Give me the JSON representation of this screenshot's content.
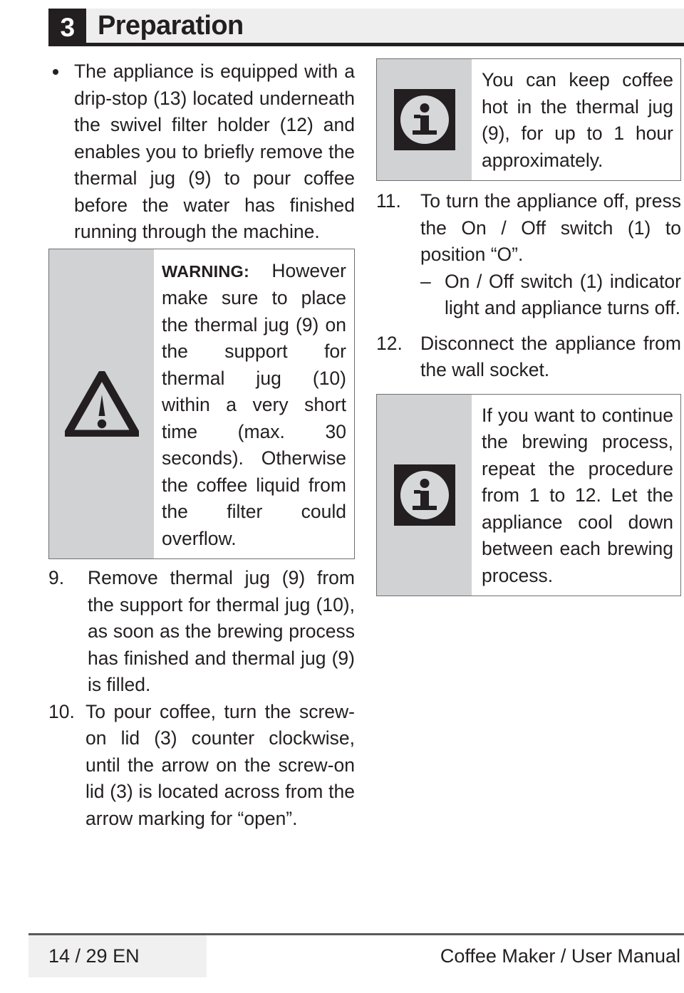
{
  "header": {
    "chapter_number": "3",
    "chapter_title": "Preparation"
  },
  "left_column": {
    "bullet": {
      "text": "The appliance is equipped with a drip-stop (13) located underneath the swivel filter holder (12) and enables you to briefly remove the thermal jug (9) to pour coffee before the water has finished running through the machine."
    },
    "warning_box": {
      "icon": "warning-triangle-icon",
      "label": "WARNING:",
      "text": "However make sure to place the thermal jug (9) on the support for thermal jug (10) within a very short time (max. 30 seconds). Otherwise the coffee liquid from the filter could overflow."
    },
    "steps": [
      {
        "number": "9.",
        "text": "Remove thermal jug (9) from the support for thermal jug (10), as soon as the brewing process has finished and thermal jug (9) is filled."
      },
      {
        "number": "10.",
        "text": "To pour coffee, turn the screw-on lid (3) counter clockwise, until the arrow on the screw-on lid (3) is located across from the arrow marking for “open”."
      }
    ]
  },
  "right_column": {
    "info_box_top": {
      "icon": "info-icon",
      "text": "You can keep coffee hot in the thermal jug (9), for up to 1 hour approximately."
    },
    "steps": [
      {
        "number": "11.",
        "text": "To turn the appliance off, press the On / Off switch (1) to position “O”.",
        "subitem": {
          "marker": "–",
          "text": "On / Off switch (1) indicator light and appliance turns off."
        }
      },
      {
        "number": "12.",
        "text": "Disconnect the appliance from the wall socket."
      }
    ],
    "info_box_bottom": {
      "icon": "info-icon",
      "text": "If you want to continue the brewing process, repeat the procedure from 1 to 12. Let the appliance cool down between each brewing process."
    }
  },
  "footer": {
    "page_label": "14 / 29  EN",
    "manual_title": "Coffee Maker / User Manual"
  },
  "colors": {
    "ink": "#231f20",
    "header_band": "#eeeeee",
    "notice_gray": "#d0d2d3",
    "notice_border": "#6f6f6f",
    "footer_gray": "#f0f0f0"
  }
}
